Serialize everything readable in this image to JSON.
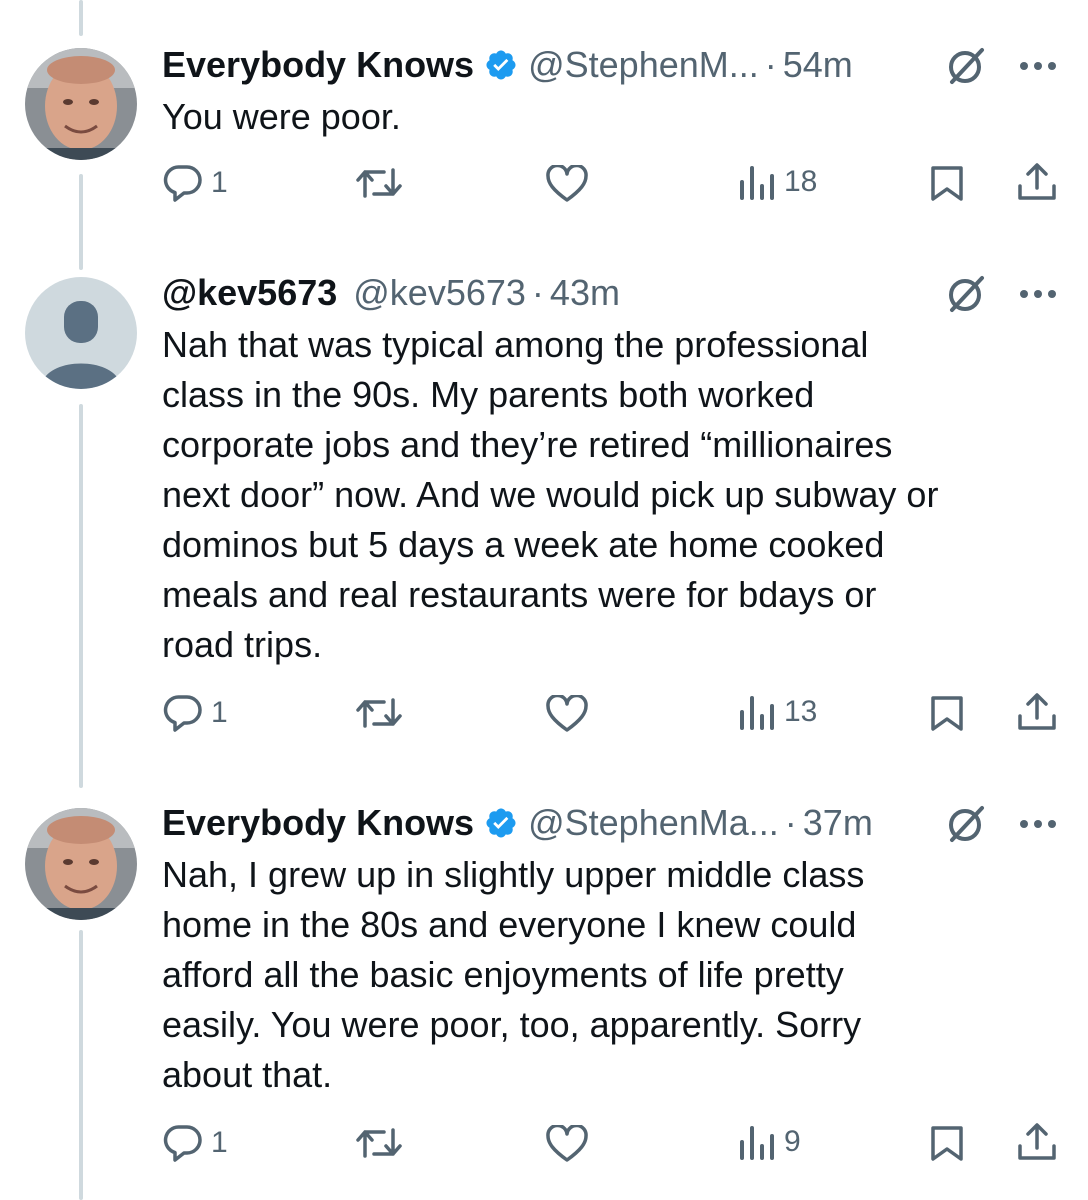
{
  "tweets": [
    {
      "display_name": "Everybody Knows",
      "handle": "@StephenM...",
      "separator": "·",
      "time": "54m",
      "text": "You were poor.",
      "verified": true,
      "avatar": "photo-avatar",
      "replies": "1",
      "views": "18"
    },
    {
      "display_name": "@kev5673",
      "handle": "@kev5673",
      "separator": "·",
      "time": "43m",
      "text": "Nah that was typical among the professional\nclass in the 90s. My parents both worked\ncorporate jobs and they’re retired “millionaires\nnext door” now. And we would pick up subway or\ndominos but 5 days a week ate home cooked\nmeals and real restaurants were for bdays or\nroad trips.",
      "verified": false,
      "avatar": "default-avatar",
      "replies": "1",
      "views": "13"
    },
    {
      "display_name": "Everybody Knows",
      "handle": "@StephenMa...",
      "separator": "·",
      "time": "37m",
      "text": "Nah, I grew up in slightly upper middle class\nhome in the 80s and everyone I knew could\nafford all the basic enjoyments of life pretty\neasily. You were poor, too, apparently. Sorry\nabout that.",
      "verified": true,
      "avatar": "photo-avatar",
      "replies": "1",
      "views": "9"
    }
  ],
  "colors": {
    "text": "#0f1419",
    "secondary": "#536471",
    "verified": "#1d9bf0",
    "thread_line": "#cfd9de"
  },
  "icons": [
    "reply-icon",
    "retweet-icon",
    "like-icon",
    "views-icon",
    "bookmark-icon",
    "share-icon",
    "grok-icon",
    "more-icon",
    "verified-badge-icon"
  ]
}
